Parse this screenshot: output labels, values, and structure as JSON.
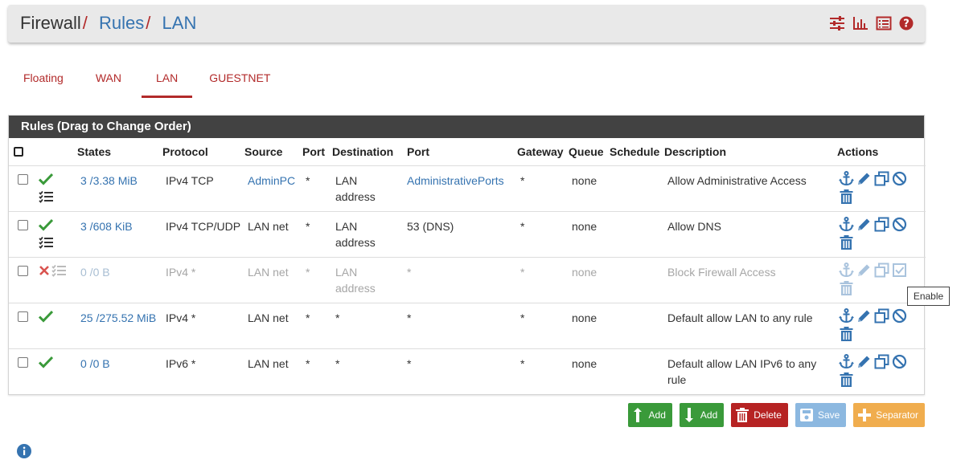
{
  "breadcrumb": {
    "firewall": "Firewall",
    "rules": "Rules",
    "lan": "LAN",
    "separator": "/"
  },
  "header_icons": [
    "sliders-icon",
    "bar-chart-icon",
    "list-icon",
    "help-icon"
  ],
  "tabs": [
    {
      "label": "Floating",
      "active": false
    },
    {
      "label": "WAN",
      "active": false
    },
    {
      "label": "LAN",
      "active": true
    },
    {
      "label": "GUESTNET",
      "active": false
    }
  ],
  "panel": {
    "title": "Rules (Drag to Change Order)"
  },
  "columns": {
    "states": "States",
    "protocol": "Protocol",
    "source": "Source",
    "port": "Port",
    "destination": "Destination",
    "dest_port": "Port",
    "gateway": "Gateway",
    "queue": "Queue",
    "schedule": "Schedule",
    "description": "Description",
    "actions": "Actions"
  },
  "rules": [
    {
      "status": "pass",
      "has_list_icon": true,
      "disabled": false,
      "states": "3 /3.38 MiB",
      "protocol": "IPv4 TCP",
      "source": "AdminPC",
      "source_link": true,
      "port": "*",
      "destination": "LAN address",
      "dest_port": "AdministrativePorts",
      "dest_port_link": true,
      "gateway": "*",
      "queue": "none",
      "schedule": "",
      "description": "Allow Administrative Access"
    },
    {
      "status": "pass",
      "has_list_icon": true,
      "disabled": false,
      "states": "3 /608 KiB",
      "protocol": "IPv4 TCP/UDP",
      "source": "LAN net",
      "source_link": false,
      "port": "*",
      "destination": "LAN address",
      "dest_port": "53 (DNS)",
      "dest_port_link": false,
      "gateway": "*",
      "queue": "none",
      "schedule": "",
      "description": "Allow DNS"
    },
    {
      "status": "block",
      "has_list_icon": true,
      "disabled": true,
      "states": "0 /0 B",
      "protocol": "IPv4 *",
      "source": "LAN net",
      "source_link": false,
      "port": "*",
      "destination": "LAN address",
      "dest_port": "*",
      "dest_port_link": false,
      "gateway": "*",
      "queue": "none",
      "schedule": "",
      "description": "Block Firewall Access"
    },
    {
      "status": "pass",
      "has_list_icon": false,
      "disabled": false,
      "states": "25 /275.52 MiB",
      "protocol": "IPv4 *",
      "source": "LAN net",
      "source_link": false,
      "port": "*",
      "destination": "*",
      "dest_port": "*",
      "dest_port_link": false,
      "gateway": "*",
      "queue": "none",
      "schedule": "",
      "description": "Default allow LAN to any rule"
    },
    {
      "status": "pass",
      "has_list_icon": false,
      "disabled": false,
      "states": "0 /0 B",
      "protocol": "IPv6 *",
      "source": "LAN net",
      "source_link": false,
      "port": "*",
      "destination": "*",
      "dest_port": "*",
      "dest_port_link": false,
      "gateway": "*",
      "queue": "none",
      "schedule": "",
      "description": "Default allow LAN IPv6 to any rule"
    }
  ],
  "tooltip": "Enable",
  "buttons": {
    "add_top": "Add",
    "add_bottom": "Add",
    "delete": "Delete",
    "save": "Save",
    "separator": "Separator"
  },
  "colors": {
    "brand_red": "#b22a2a",
    "link_blue": "#3573b0",
    "pass_green": "#3a9a3a",
    "block_red": "#d9534f"
  }
}
